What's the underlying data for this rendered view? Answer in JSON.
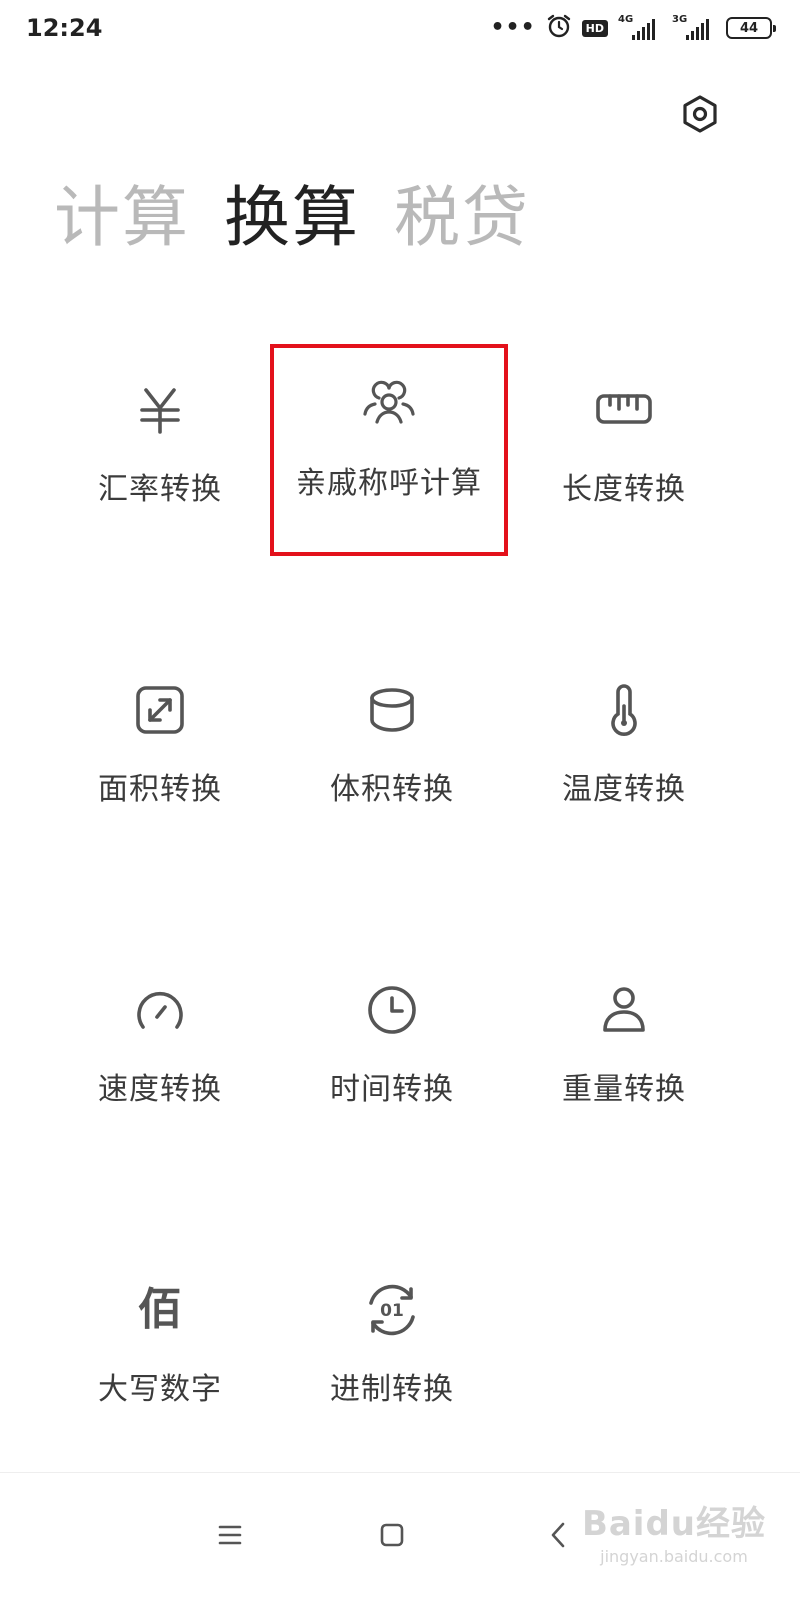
{
  "status_bar": {
    "time": "12:24",
    "dots": "•••",
    "alarm_icon": "alarm-clock-icon",
    "hd_badge": "HD",
    "network_1": "4G",
    "network_2": "3G",
    "battery": "44"
  },
  "settings_icon": "gear-icon",
  "tabs": [
    {
      "label": "计算",
      "active": false
    },
    {
      "label": "换算",
      "active": true
    },
    {
      "label": "税贷",
      "active": false
    }
  ],
  "tools": [
    {
      "label": "汇率转换",
      "icon": "yen-icon"
    },
    {
      "label": "亲戚称呼计算",
      "icon": "people-icon",
      "highlighted": true
    },
    {
      "label": "长度转换",
      "icon": "ruler-icon"
    },
    {
      "label": "面积转换",
      "icon": "expand-square-icon"
    },
    {
      "label": "体积转换",
      "icon": "cylinder-icon"
    },
    {
      "label": "温度转换",
      "icon": "thermometer-icon"
    },
    {
      "label": "速度转换",
      "icon": "speedometer-icon"
    },
    {
      "label": "时间转换",
      "icon": "clock-icon"
    },
    {
      "label": "重量转换",
      "icon": "weight-icon"
    },
    {
      "label": "大写数字",
      "icon": "bai-character-icon",
      "glyph": "佰"
    },
    {
      "label": "进制转换",
      "icon": "binary-cycle-icon",
      "glyph": "01"
    }
  ],
  "highlight_color": "#e3111b",
  "watermark": {
    "main": "Baidu经验",
    "sub": "jingyan.baidu.com"
  },
  "nav_icons": [
    "menu-icon",
    "home-square-icon",
    "back-chevron-icon"
  ]
}
